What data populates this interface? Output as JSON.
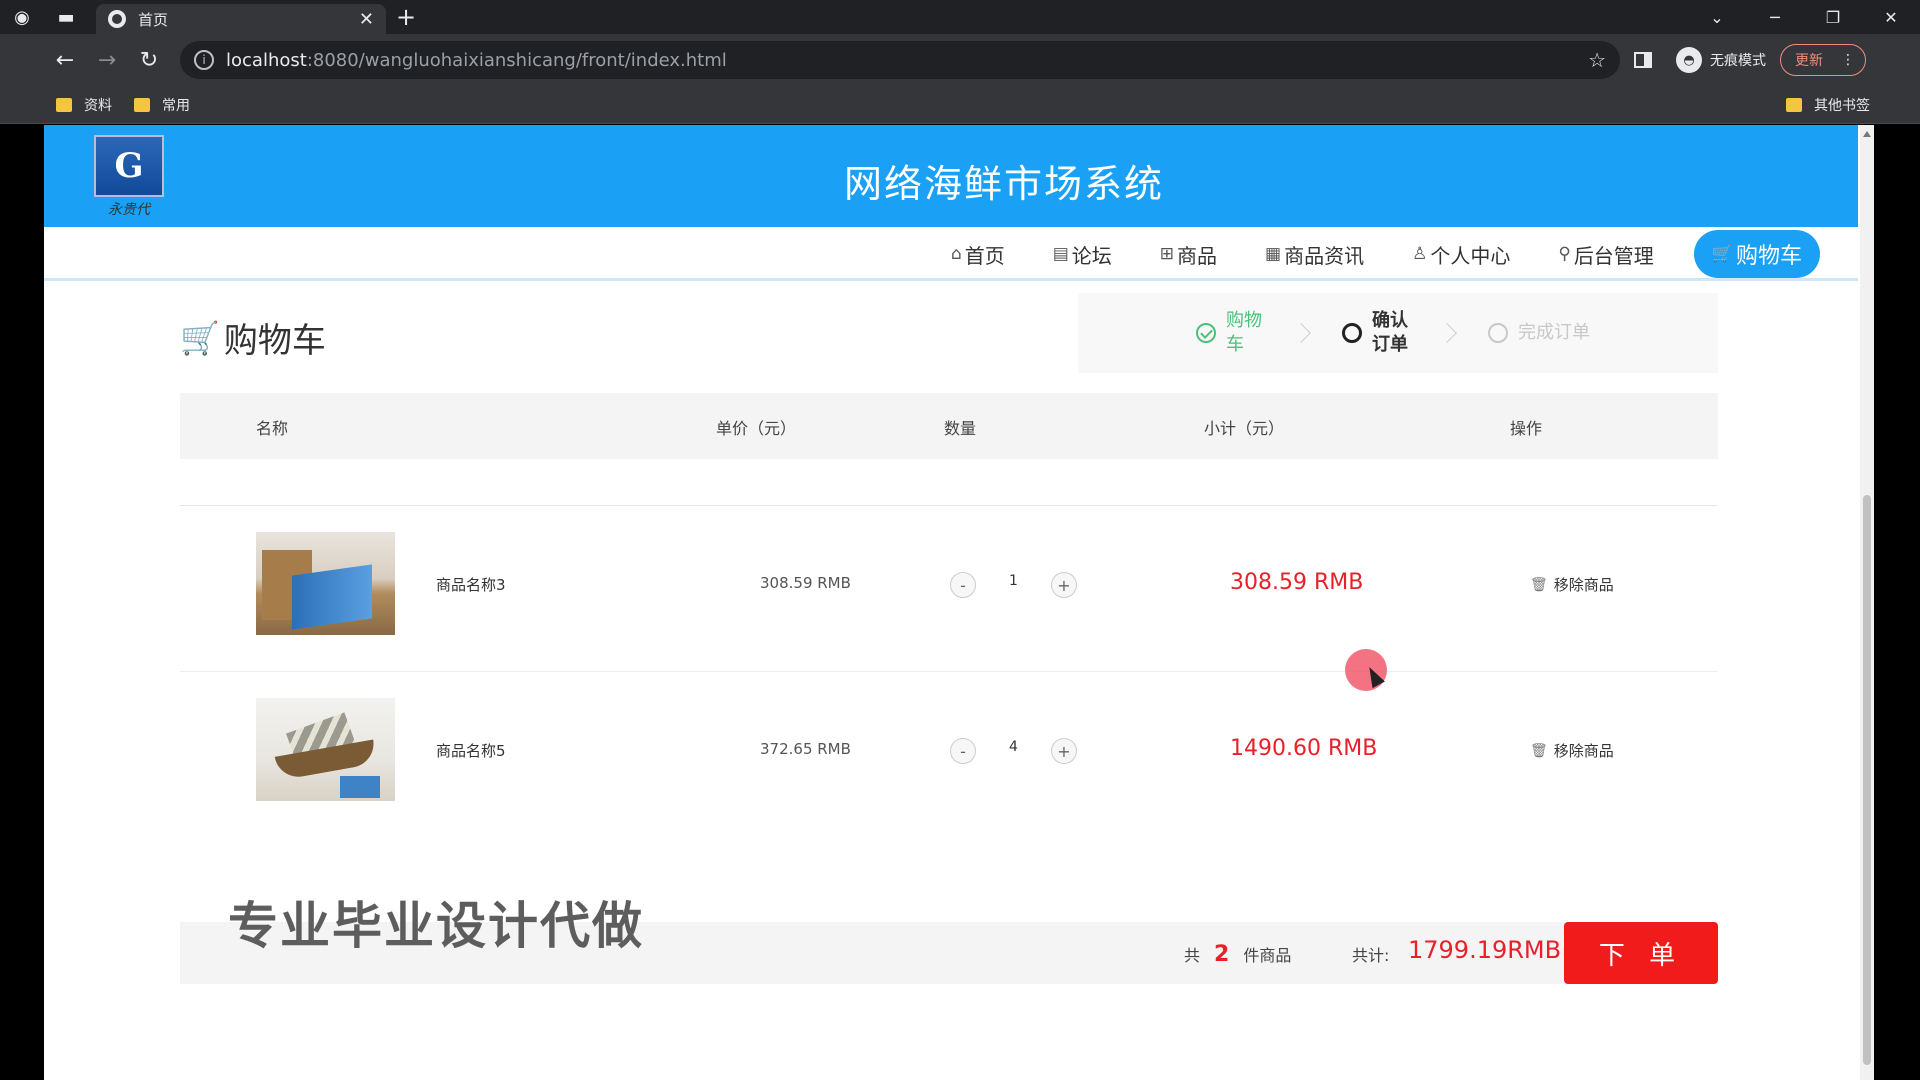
{
  "browser": {
    "tab_title": "首页",
    "url_host": "localhost",
    "url_path": ":8080/wangluohaixianshicang/front/index.html",
    "incognito_label": "无痕模式",
    "update_label": "更新",
    "bookmarks": [
      "资料",
      "常用"
    ],
    "other_bookmarks": "其他书签"
  },
  "site": {
    "title": "网络海鲜市场系统",
    "logo_mark": "G",
    "logo_signature": "永贵代"
  },
  "nav": {
    "items": [
      {
        "icon": "⌂",
        "label": "首页"
      },
      {
        "icon": "▤",
        "label": "论坛"
      },
      {
        "icon": "⊞",
        "label": "商品"
      },
      {
        "icon": "▦",
        "label": "商品资讯"
      },
      {
        "icon": "♙",
        "label": "个人中心"
      },
      {
        "icon": "⚲",
        "label": "后台管理"
      },
      {
        "icon": "🛒",
        "label": "购物车"
      }
    ]
  },
  "cart": {
    "title": "购物车",
    "steps": [
      {
        "label": "购物车",
        "state": "done"
      },
      {
        "label": "确认订单",
        "state": "current"
      },
      {
        "label": "完成订单",
        "state": "todo"
      }
    ],
    "columns": [
      "名称",
      "单价（元）",
      "数量",
      "小计（元）",
      "操作"
    ],
    "items": [
      {
        "name": "商品名称3",
        "price": "308.59 RMB",
        "qty": "1",
        "subtotal": "308.59 RMB",
        "action": "移除商品"
      },
      {
        "name": "商品名称5",
        "price": "372.65 RMB",
        "qty": "4",
        "subtotal": "1490.60 RMB",
        "action": "移除商品"
      }
    ],
    "qty_minus": "-",
    "qty_plus": "+",
    "summary": {
      "prefix": "共",
      "count": "2",
      "suffix": "件商品",
      "total_label": "共计:",
      "total_value": "1799.19RMB",
      "order_button": "下 单"
    },
    "watermark": "专业毕业设计代做"
  },
  "colors": {
    "brand_blue": "#1aa1f5",
    "price_red": "#e8202a",
    "order_red": "#f21b1b",
    "step_green": "#4cc07a"
  }
}
